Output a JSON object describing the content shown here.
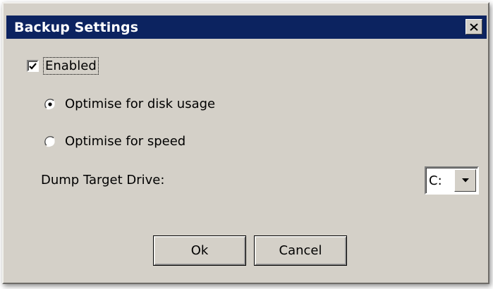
{
  "window": {
    "title": "Backup Settings",
    "close_icon": "close-icon"
  },
  "enabled_checkbox": {
    "label": "Enabled",
    "checked": true
  },
  "optimise": {
    "options": [
      {
        "label": "Optimise for disk usage",
        "selected": true
      },
      {
        "label": "Optimise for speed",
        "selected": false
      }
    ]
  },
  "dump_target": {
    "label": "Dump Target Drive:",
    "selected_value": "C:",
    "arrow_icon": "chevron-down-icon"
  },
  "buttons": {
    "ok_label": "Ok",
    "cancel_label": "Cancel"
  },
  "colors": {
    "titlebar": "#0c2360",
    "dialog_face": "#d4d0c8"
  }
}
